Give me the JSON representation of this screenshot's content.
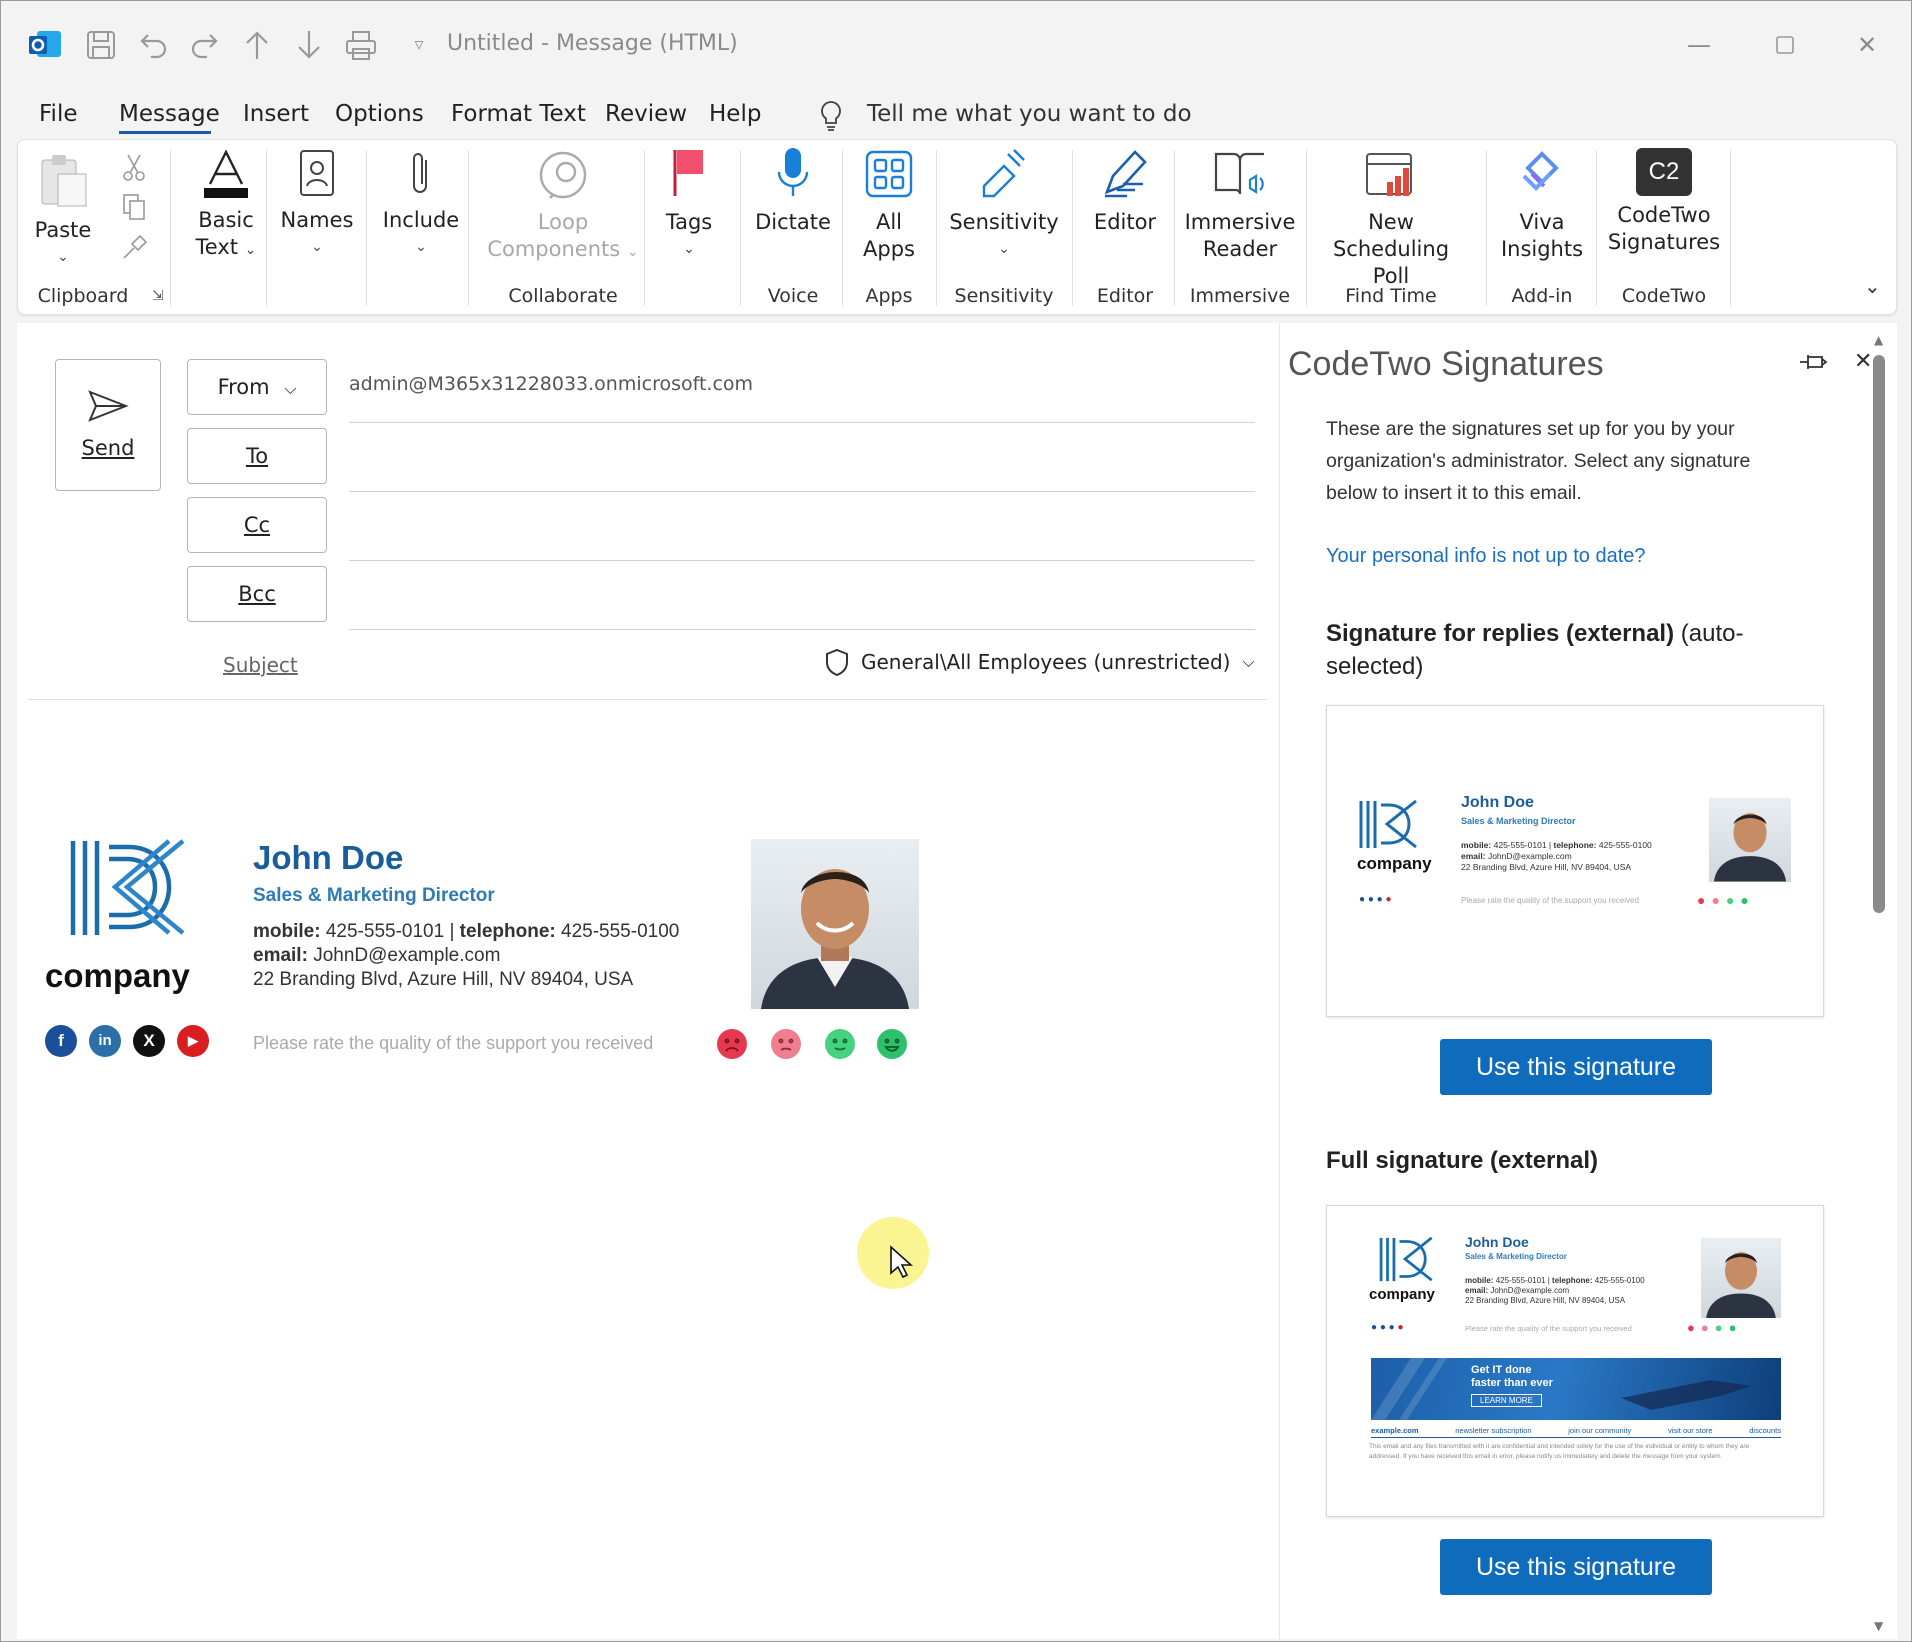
{
  "titlebar": {
    "title": "Untitled  -  Message (HTML)",
    "icons": [
      "outlook-app-icon",
      "save-icon",
      "undo-icon",
      "redo-icon",
      "up-arrow-icon",
      "down-arrow-icon",
      "print-icon",
      "customize-qat-icon"
    ],
    "controls": [
      "minimize-icon",
      "maximize-icon",
      "close-icon"
    ]
  },
  "menu": {
    "tabs": [
      "File",
      "Message",
      "Insert",
      "Options",
      "Format Text",
      "Review",
      "Help"
    ],
    "active": "Message",
    "tell_me": "Tell me what you want to do"
  },
  "ribbon": {
    "paste": "Paste",
    "basic_text_1": "Basic",
    "basic_text_2": "Text",
    "names": "Names",
    "include": "Include",
    "loop_1": "Loop",
    "loop_2": "Components",
    "tags": "Tags",
    "dictate": "Dictate",
    "all_apps_1": "All",
    "all_apps_2": "Apps",
    "sensitivity": "Sensitivity",
    "editor": "Editor",
    "immersive_1": "Immersive",
    "immersive_2": "Reader",
    "poll_1": "New",
    "poll_2": "Scheduling Poll",
    "viva_1": "Viva",
    "viva_2": "Insights",
    "codetwo_1": "CodeTwo",
    "codetwo_2": "Signatures",
    "codetwo_logo": "C2",
    "groups": {
      "clipboard": "Clipboard",
      "collaborate": "Collaborate",
      "voice": "Voice",
      "apps": "Apps",
      "sensitivity": "Sensitivity",
      "editor": "Editor",
      "immersive": "Immersive",
      "find_time": "Find Time",
      "add_in": "Add-in",
      "codetwo": "CodeTwo"
    }
  },
  "compose": {
    "send": "Send",
    "from_label": "From",
    "from_value": "admin@M365x31228033.onmicrosoft.com",
    "to_label": "To",
    "cc_label": "Cc",
    "bcc_label": "Bcc",
    "subject_label": "Subject",
    "sensitivity_label": "General\\All Employees (unrestricted)"
  },
  "signature": {
    "logo_text": "company",
    "name": "John Doe",
    "title": "Sales & Marketing Director",
    "mobile_label": "mobile:",
    "mobile": "425-555-0101",
    "telephone_label": "telephone:",
    "telephone": "425-555-0100",
    "email_label": "email:",
    "email": "JohnD@example.com",
    "address": "22 Branding Blvd, Azure Hill, NV 89404, USA",
    "rating_prompt": "Please rate the quality of the support you received",
    "social": [
      "f",
      "in",
      "X",
      "▶"
    ]
  },
  "panel": {
    "title": "CodeTwo Signatures",
    "intro": "These are the signatures set up for you by your organization's administrator. Select any signature below to insert it to this email.",
    "personal_info_link": "Your personal info is not up to date?",
    "sig1_title_bold": "Signature for replies (external)",
    "sig1_title_rest": " (auto-selected)",
    "use_button": "Use this signature",
    "sig2_title": "Full signature (external)",
    "banner_line1": "Get IT done",
    "banner_line2": "faster than ever",
    "banner_button": "LEARN MORE",
    "footer_links": [
      "example.com",
      "newsletter subscription",
      "join our community",
      "visit our store",
      "discounts"
    ],
    "disclaimer": "This email and any files transmitted with it are confidential and intended solely for the use of the individual or entity to whom they are addressed. If you have received this email in error, please notify us immediately and delete the message from your system."
  },
  "colors": {
    "accent": "#0f6cbd",
    "sig_name": "#1a5d9a",
    "sig_title": "#2e7bb8",
    "link": "#1a6fc4"
  }
}
